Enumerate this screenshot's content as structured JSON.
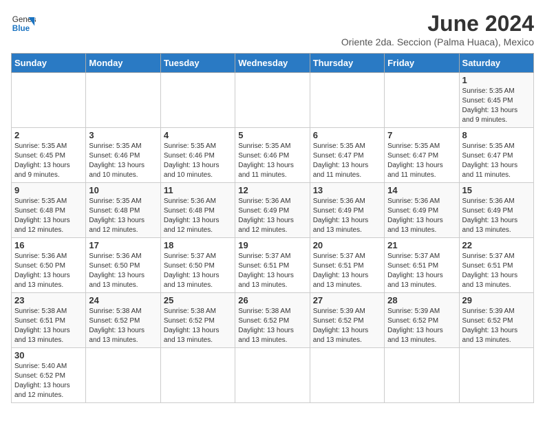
{
  "header": {
    "logo_line1": "General",
    "logo_line2": "Blue",
    "main_title": "June 2024",
    "subtitle": "Oriente 2da. Seccion (Palma Huaca), Mexico"
  },
  "weekdays": [
    "Sunday",
    "Monday",
    "Tuesday",
    "Wednesday",
    "Thursday",
    "Friday",
    "Saturday"
  ],
  "weeks": [
    [
      {
        "day": "",
        "info": ""
      },
      {
        "day": "",
        "info": ""
      },
      {
        "day": "",
        "info": ""
      },
      {
        "day": "",
        "info": ""
      },
      {
        "day": "",
        "info": ""
      },
      {
        "day": "",
        "info": ""
      },
      {
        "day": "1",
        "info": "Sunrise: 5:35 AM\nSunset: 6:45 PM\nDaylight: 13 hours\nand 9 minutes."
      }
    ],
    [
      {
        "day": "2",
        "info": "Sunrise: 5:35 AM\nSunset: 6:45 PM\nDaylight: 13 hours\nand 9 minutes."
      },
      {
        "day": "3",
        "info": "Sunrise: 5:35 AM\nSunset: 6:46 PM\nDaylight: 13 hours\nand 10 minutes."
      },
      {
        "day": "4",
        "info": "Sunrise: 5:35 AM\nSunset: 6:46 PM\nDaylight: 13 hours\nand 10 minutes."
      },
      {
        "day": "5",
        "info": "Sunrise: 5:35 AM\nSunset: 6:46 PM\nDaylight: 13 hours\nand 11 minutes."
      },
      {
        "day": "6",
        "info": "Sunrise: 5:35 AM\nSunset: 6:47 PM\nDaylight: 13 hours\nand 11 minutes."
      },
      {
        "day": "7",
        "info": "Sunrise: 5:35 AM\nSunset: 6:47 PM\nDaylight: 13 hours\nand 11 minutes."
      },
      {
        "day": "8",
        "info": "Sunrise: 5:35 AM\nSunset: 6:47 PM\nDaylight: 13 hours\nand 11 minutes."
      }
    ],
    [
      {
        "day": "9",
        "info": "Sunrise: 5:35 AM\nSunset: 6:48 PM\nDaylight: 13 hours\nand 12 minutes."
      },
      {
        "day": "10",
        "info": "Sunrise: 5:35 AM\nSunset: 6:48 PM\nDaylight: 13 hours\nand 12 minutes."
      },
      {
        "day": "11",
        "info": "Sunrise: 5:36 AM\nSunset: 6:48 PM\nDaylight: 13 hours\nand 12 minutes."
      },
      {
        "day": "12",
        "info": "Sunrise: 5:36 AM\nSunset: 6:49 PM\nDaylight: 13 hours\nand 12 minutes."
      },
      {
        "day": "13",
        "info": "Sunrise: 5:36 AM\nSunset: 6:49 PM\nDaylight: 13 hours\nand 13 minutes."
      },
      {
        "day": "14",
        "info": "Sunrise: 5:36 AM\nSunset: 6:49 PM\nDaylight: 13 hours\nand 13 minutes."
      },
      {
        "day": "15",
        "info": "Sunrise: 5:36 AM\nSunset: 6:49 PM\nDaylight: 13 hours\nand 13 minutes."
      }
    ],
    [
      {
        "day": "16",
        "info": "Sunrise: 5:36 AM\nSunset: 6:50 PM\nDaylight: 13 hours\nand 13 minutes."
      },
      {
        "day": "17",
        "info": "Sunrise: 5:36 AM\nSunset: 6:50 PM\nDaylight: 13 hours\nand 13 minutes."
      },
      {
        "day": "18",
        "info": "Sunrise: 5:37 AM\nSunset: 6:50 PM\nDaylight: 13 hours\nand 13 minutes."
      },
      {
        "day": "19",
        "info": "Sunrise: 5:37 AM\nSunset: 6:51 PM\nDaylight: 13 hours\nand 13 minutes."
      },
      {
        "day": "20",
        "info": "Sunrise: 5:37 AM\nSunset: 6:51 PM\nDaylight: 13 hours\nand 13 minutes."
      },
      {
        "day": "21",
        "info": "Sunrise: 5:37 AM\nSunset: 6:51 PM\nDaylight: 13 hours\nand 13 minutes."
      },
      {
        "day": "22",
        "info": "Sunrise: 5:37 AM\nSunset: 6:51 PM\nDaylight: 13 hours\nand 13 minutes."
      }
    ],
    [
      {
        "day": "23",
        "info": "Sunrise: 5:38 AM\nSunset: 6:51 PM\nDaylight: 13 hours\nand 13 minutes."
      },
      {
        "day": "24",
        "info": "Sunrise: 5:38 AM\nSunset: 6:52 PM\nDaylight: 13 hours\nand 13 minutes."
      },
      {
        "day": "25",
        "info": "Sunrise: 5:38 AM\nSunset: 6:52 PM\nDaylight: 13 hours\nand 13 minutes."
      },
      {
        "day": "26",
        "info": "Sunrise: 5:38 AM\nSunset: 6:52 PM\nDaylight: 13 hours\nand 13 minutes."
      },
      {
        "day": "27",
        "info": "Sunrise: 5:39 AM\nSunset: 6:52 PM\nDaylight: 13 hours\nand 13 minutes."
      },
      {
        "day": "28",
        "info": "Sunrise: 5:39 AM\nSunset: 6:52 PM\nDaylight: 13 hours\nand 13 minutes."
      },
      {
        "day": "29",
        "info": "Sunrise: 5:39 AM\nSunset: 6:52 PM\nDaylight: 13 hours\nand 13 minutes."
      }
    ],
    [
      {
        "day": "30",
        "info": "Sunrise: 5:40 AM\nSunset: 6:52 PM\nDaylight: 13 hours\nand 12 minutes."
      },
      {
        "day": "",
        "info": ""
      },
      {
        "day": "",
        "info": ""
      },
      {
        "day": "",
        "info": ""
      },
      {
        "day": "",
        "info": ""
      },
      {
        "day": "",
        "info": ""
      },
      {
        "day": "",
        "info": ""
      }
    ]
  ]
}
